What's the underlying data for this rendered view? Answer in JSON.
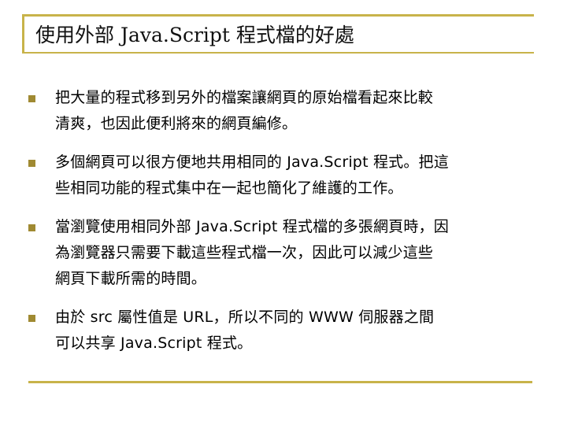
{
  "title": "使用外部 Java.Script 程式檔的好處",
  "bullets": [
    {
      "icon": "square-bullet-icon",
      "lines": [
        "把大量的程式移到另外的檔案讓網頁的原始檔看起來比較",
        "清爽，也因此便利將來的網頁編修。"
      ]
    },
    {
      "icon": "square-bullet-icon",
      "lines": [
        "多個網頁可以很方便地共用相同的 Java.Script 程式。把這",
        "些相同功能的程式集中在一起也簡化了維護的工作。"
      ]
    },
    {
      "icon": "square-bullet-icon",
      "lines": [
        "當瀏覽使用相同外部 Java.Script 程式檔的多張網頁時，因",
        "為瀏覽器只需要下載這些程式檔一次，因此可以減少這些",
        "網頁下載所需的時間。"
      ]
    },
    {
      "icon": "square-bullet-icon",
      "lines": [
        "由於 src 屬性值是 URL，所以不同的 WWW 伺服器之間",
        "可以共享 Java.Script 程式。"
      ]
    }
  ],
  "colors": {
    "accent": "#c8b34a",
    "bullet": "#a08a32"
  }
}
